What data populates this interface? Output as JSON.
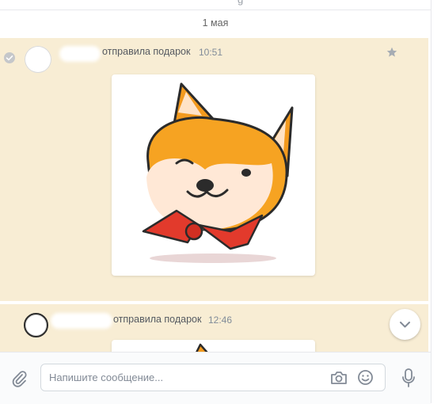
{
  "header": {
    "top_fragment": "g"
  },
  "date_separator": "1 мая",
  "messages": [
    {
      "action": "отправила подарок",
      "time": "10:51"
    },
    {
      "action": "отправила подарок",
      "time": "12:46"
    }
  ],
  "composer": {
    "placeholder": "Напишите сообщение..."
  },
  "colors": {
    "message_bg": "#f8edd4",
    "icon_gray": "#828a96",
    "accent": "#5181b8"
  }
}
